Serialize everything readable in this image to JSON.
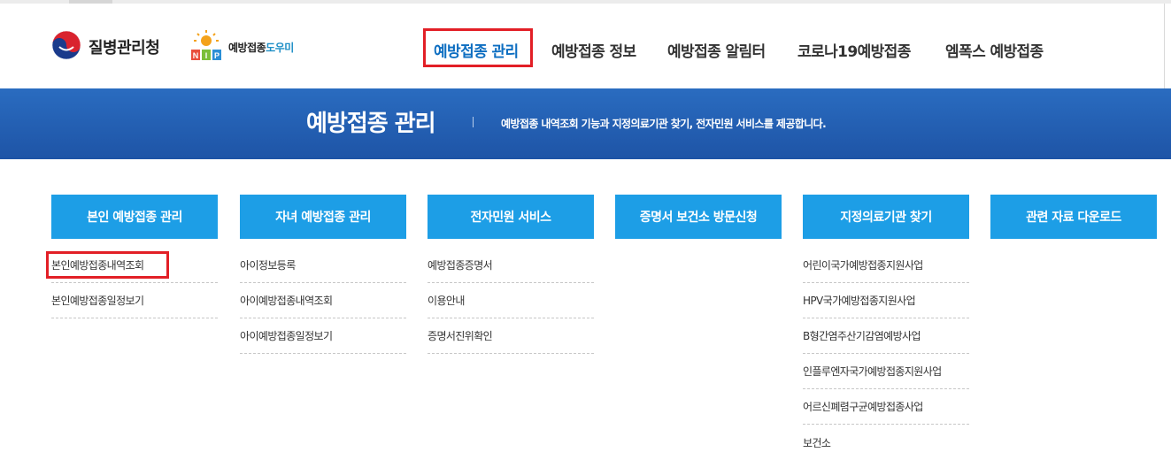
{
  "header": {
    "org_name": "질병관리청",
    "site_logo": {
      "text_a": "예방접종",
      "text_b": "도우미"
    }
  },
  "nav": {
    "items": [
      {
        "label": "예방접종 관리",
        "active": true
      },
      {
        "label": "예방접종 정보",
        "active": false
      },
      {
        "label": "예방접종 알림터",
        "active": false
      },
      {
        "label": "코로나19예방접종",
        "active": false
      },
      {
        "label": "엠폭스 예방접종",
        "active": false
      }
    ]
  },
  "banner": {
    "title": "예방접종 관리",
    "description": "예방접종 내역조회 기능과 지정의료기관 찾기, 전자민원 서비스를 제공합니다."
  },
  "sections": [
    {
      "title": "본인 예방접종 관리",
      "items": [
        "본인예방접종내역조회",
        "본인예방접종일정보기"
      ]
    },
    {
      "title": "자녀 예방접종 관리",
      "items": [
        "아이정보등록",
        "아이예방접종내역조회",
        "아이예방접종일정보기"
      ]
    },
    {
      "title": "전자민원 서비스",
      "items": [
        "예방접종증명서",
        "이용안내",
        "증명서진위확인"
      ]
    },
    {
      "title": "증명서 보건소 방문신청",
      "items": []
    },
    {
      "title": "지정의료기관 찾기",
      "items": [
        "어린이국가예방접종지원사업",
        "HPV국가예방접종지원사업",
        "B형간염주산기감염예방사업",
        "인플루엔자국가예방접종지원사업",
        "어르신폐렴구균예방접종사업",
        "보건소"
      ]
    },
    {
      "title": "관련 자료 다운로드",
      "items": []
    }
  ],
  "colors": {
    "accent_blue": "#1d9ee6",
    "banner_blue": "#1e54a6",
    "active_nav": "#0d6ec1",
    "highlight_red": "#e21f26"
  },
  "icons": [
    "kdca-emblem-icon",
    "nip-logo-icon"
  ]
}
